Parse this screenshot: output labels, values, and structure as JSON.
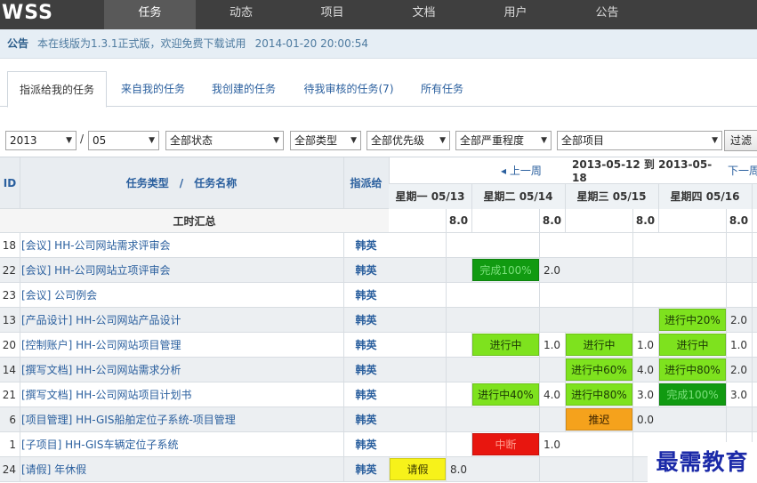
{
  "app": {
    "logo": "WSS",
    "nav": [
      "任务",
      "动态",
      "项目",
      "文档",
      "用户",
      "公告"
    ],
    "active_nav": "任务"
  },
  "announcement": {
    "title": "公告",
    "text": "本在线版为1.3.1正式版，欢迎免费下载试用",
    "time": "2014-01-20 20:00:54"
  },
  "tabs": [
    "指派给我的任务",
    "来自我的任务",
    "我创建的任务",
    "待我审核的任务(7)",
    "所有任务"
  ],
  "active_tab": "指派给我的任务",
  "filters": {
    "year": "2013",
    "separator": "/",
    "month": "05",
    "status": "全部状态",
    "type": "全部类型",
    "priority": "全部优先级",
    "severity": "全部严重程度",
    "project": "全部项目",
    "filter_button": "过滤"
  },
  "table": {
    "col_id": "ID",
    "col_type": "任务类型",
    "col_sep": "/",
    "col_name": "任务名称",
    "col_assignee": "指派给",
    "prev_week": "◂ 上一周",
    "range": "2013-05-12 到 2013-05-18",
    "next_week": "下一周",
    "days": [
      "星期一 05/13",
      "星期二 05/14",
      "星期三 05/15",
      "星期四 05/16"
    ],
    "day_hours": [
      "8.0",
      "8.0",
      "8.0",
      "8.0"
    ],
    "summary_label": "工时汇总",
    "rows": [
      {
        "id": "18",
        "task": "[会议] HH-公司网站需求评审会",
        "assignee": "韩英",
        "cells": [
          null,
          null,
          null,
          null
        ]
      },
      {
        "id": "22",
        "task": "[会议] HH-公司网站立项评审会",
        "assignee": "韩英",
        "cells": [
          null,
          {
            "status": "完成100%",
            "color": "#119a11",
            "fg": "#7be07b",
            "hours": "2.0"
          },
          null,
          null
        ]
      },
      {
        "id": "23",
        "task": "[会议] 公司例会",
        "assignee": "韩英",
        "cells": [
          null,
          null,
          null,
          null
        ]
      },
      {
        "id": "13",
        "task": "[产品设计] HH-公司网站产品设计",
        "assignee": "韩英",
        "cells": [
          null,
          null,
          null,
          {
            "status": "进行中20%",
            "color": "#7ee21e",
            "fg": "#1c3a05",
            "hours": "2.0"
          }
        ]
      },
      {
        "id": "20",
        "task": "[控制账户] HH-公司网站项目管理",
        "assignee": "韩英",
        "cells": [
          null,
          {
            "status": "进行中",
            "color": "#7ee21e",
            "fg": "#1c3a05",
            "hours": "1.0"
          },
          {
            "status": "进行中",
            "color": "#7ee21e",
            "fg": "#1c3a05",
            "hours": "1.0"
          },
          {
            "status": "进行中",
            "color": "#7ee21e",
            "fg": "#1c3a05",
            "hours": "1.0"
          }
        ]
      },
      {
        "id": "14",
        "task": "[撰写文档] HH-公司网站需求分析",
        "assignee": "韩英",
        "cells": [
          null,
          null,
          {
            "status": "进行中60%",
            "color": "#7ee21e",
            "fg": "#1c3a05",
            "hours": "4.0"
          },
          {
            "status": "进行中80%",
            "color": "#7ee21e",
            "fg": "#1c3a05",
            "hours": "2.0"
          }
        ]
      },
      {
        "id": "21",
        "task": "[撰写文档] HH-公司网站项目计划书",
        "assignee": "韩英",
        "cells": [
          null,
          {
            "status": "进行中40%",
            "color": "#7ee21e",
            "fg": "#1c3a05",
            "hours": "4.0"
          },
          {
            "status": "进行中80%",
            "color": "#7ee21e",
            "fg": "#1c3a05",
            "hours": "3.0"
          },
          {
            "status": "完成100%",
            "color": "#119a11",
            "fg": "#7be07b",
            "hours": "3.0"
          }
        ]
      },
      {
        "id": "6",
        "task": "[项目管理] HH-GIS船舶定位子系统-项目管理",
        "assignee": "韩英",
        "cells": [
          null,
          null,
          {
            "status": "推迟",
            "color": "#f5a21c",
            "fg": "#3a2300",
            "hours": "0.0"
          },
          null
        ]
      },
      {
        "id": "1",
        "task": "[子项目] HH-GIS车辆定位子系统",
        "assignee": "韩英",
        "cells": [
          null,
          {
            "status": "中断",
            "color": "#e8160f",
            "fg": "#ff9c8c",
            "hours": "1.0"
          },
          null,
          null
        ]
      },
      {
        "id": "24",
        "task": "[请假] 年休假",
        "assignee": "韩英",
        "cells": [
          {
            "status": "请假",
            "color": "#f7f21a",
            "fg": "#3a3800",
            "hours": "8.0"
          },
          null,
          null,
          null
        ]
      }
    ]
  },
  "watermark": "最需教育",
  "colors": {
    "nav_bg": "#3f3f3f",
    "link": "#2a5f9e",
    "done": "#119a11",
    "in_progress": "#7ee21e",
    "delayed": "#f5a21c",
    "interrupted": "#e8160f",
    "leave": "#f7f21a"
  }
}
